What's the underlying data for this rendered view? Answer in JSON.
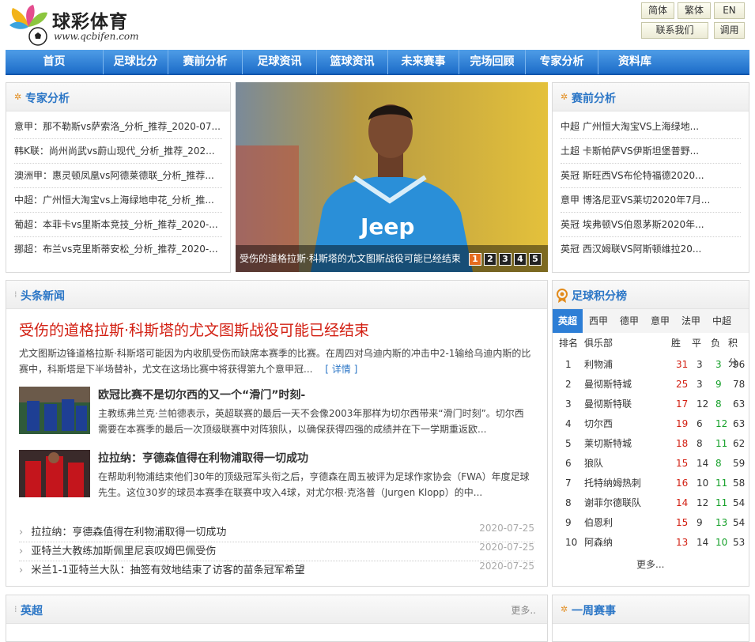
{
  "header": {
    "site_name": "球彩体育",
    "site_url": "www.qcbifen.com",
    "buttons": [
      "简体",
      "繁体",
      "EN",
      "联系我们",
      "调用"
    ]
  },
  "nav": [
    "首页",
    "足球比分",
    "赛前分析",
    "足球资讯",
    "篮球资讯",
    "未来赛事",
    "完场回顾",
    "专家分析",
    "资料库"
  ],
  "expert": {
    "title": "专家分析",
    "items": [
      "意甲：那不勒斯vs萨索洛_分析_推荐_2020-07...",
      "韩K联：尚州尚武vs蔚山现代_分析_推荐_202...",
      "澳洲甲：惠灵顿凤凰vs阿德莱德联_分析_推荐...",
      "中超：广州恒大淘宝vs上海绿地申花_分析_推...",
      "葡超：本菲卡vs里斯本竞技_分析_推荐_2020-...",
      "挪超：布兰vs克里斯蒂安松_分析_推荐_2020-..."
    ]
  },
  "slider": {
    "caption": "受伤的道格拉斯·科斯塔的尤文图斯战役可能已经结束",
    "dots": [
      "1",
      "2",
      "3",
      "4",
      "5"
    ],
    "active_index": 0,
    "jersey_text": "Jeep"
  },
  "preview": {
    "title": "赛前分析",
    "items": [
      "中超 广州恒大淘宝VS上海绿地...",
      "土超 卡斯帕萨VS伊斯坦堡普野...",
      "英冠 斯旺西VS布伦特福德2020...",
      "意甲 博洛尼亚VS莱切2020年7月...",
      "英冠 埃弗顿VS伯恩茅斯2020年...",
      "英冠 西汉姆联VS阿斯顿维拉20..."
    ]
  },
  "headlines": {
    "title": "头条新闻",
    "top_title": "受伤的道格拉斯·科斯塔的尤文图斯战役可能已经结束",
    "top_summary": "尤文图斯边锋道格拉斯·科斯塔可能因为内收肌受伤而缺席本赛季的比赛。在周四对乌迪内斯的冲击中2-1输给乌迪内斯的比赛中，科斯塔是下半场替补，尤文在这场比赛中将获得第九个意甲冠...",
    "detail_link": "[ 详情 ]",
    "stories": [
      {
        "title": "欧冠比赛不是切尔西的又一个“滑门”时刻-",
        "desc": "主教练弗兰克·兰帕德表示，英超联赛的最后一天不会像2003年那样为切尔西带来“滑门时刻”。切尔西需要在本赛季的最后一次顶级联赛中对阵狼队，以确保获得四强的成绩并在下一学期重返欧..."
      },
      {
        "title": "拉拉纳：亨德森值得在利物浦取得一切成功",
        "desc": "在帮助利物浦结束他们30年的顶级冠军头衔之后，亨德森在周五被评为足球作家协会（FWA）年度足球先生。这位30岁的球员本赛季在联赛中攻入4球，对尤尔根·克洛普（Jurgen Klopp）的中..."
      }
    ],
    "briefs": [
      {
        "text": "拉拉纳：亨德森值得在利物浦取得一切成功",
        "date": "2020-07-25"
      },
      {
        "text": "亚特兰大教练加斯佩里尼哀叹姆巴佩受伤",
        "date": "2020-07-25"
      },
      {
        "text": "米兰1-1亚特兰大队：抽签有效地结束了访客的苗条冠军希望",
        "date": "2020-07-25"
      }
    ]
  },
  "standings": {
    "title": "足球积分榜",
    "tabs": [
      "英超",
      "西甲",
      "德甲",
      "意甲",
      "法甲",
      "中超"
    ],
    "columns": [
      "排名",
      "俱乐部",
      "胜",
      "平",
      "负",
      "积分"
    ],
    "rows": [
      [
        "1",
        "利物浦",
        "31",
        "3",
        "3",
        "96"
      ],
      [
        "2",
        "曼彻斯特城",
        "25",
        "3",
        "9",
        "78"
      ],
      [
        "3",
        "曼彻斯特联",
        "17",
        "12",
        "8",
        "63"
      ],
      [
        "4",
        "切尔西",
        "19",
        "6",
        "12",
        "63"
      ],
      [
        "5",
        "莱切斯特城",
        "18",
        "8",
        "11",
        "62"
      ],
      [
        "6",
        "狼队",
        "15",
        "14",
        "8",
        "59"
      ],
      [
        "7",
        "托特纳姆热刺",
        "16",
        "10",
        "11",
        "58"
      ],
      [
        "8",
        "谢菲尔德联队",
        "14",
        "12",
        "11",
        "54"
      ],
      [
        "9",
        "伯恩利",
        "15",
        "9",
        "13",
        "54"
      ],
      [
        "10",
        "阿森纳",
        "13",
        "14",
        "10",
        "53"
      ]
    ],
    "more": "更多..."
  },
  "premier": {
    "title": "英超",
    "more": "更多.."
  },
  "weekly": {
    "title": "一周赛事"
  },
  "colors": {
    "brand_blue": "#1c6cc8",
    "headline_red": "#d21f12",
    "win_red": "#d21f12",
    "loss_green": "#16a02a",
    "bullet_orange": "#e28b1c"
  }
}
